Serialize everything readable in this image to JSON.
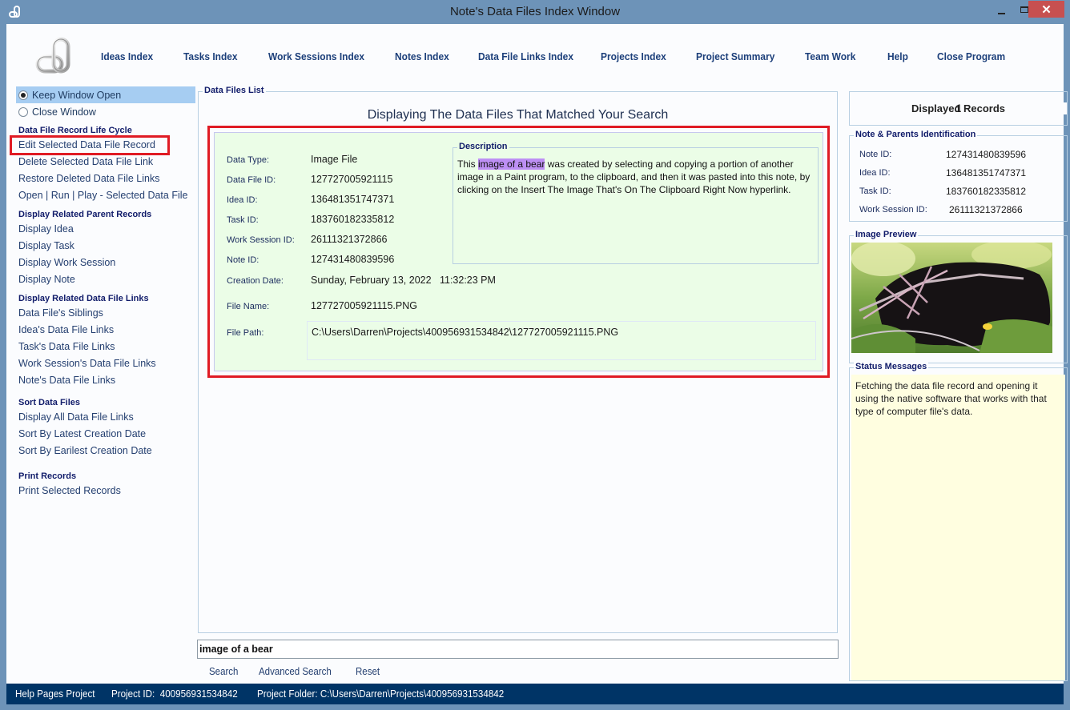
{
  "window": {
    "title": "Note's Data Files Index Window",
    "icons": [
      "app-link-icon",
      "minimize-icon",
      "maximize-icon",
      "close-icon"
    ]
  },
  "topnav": [
    {
      "label": "Ideas Index",
      "mnemonic": "I"
    },
    {
      "label": "Tasks Index",
      "mnemonic": "T"
    },
    {
      "label": "Work Sessions Index",
      "mnemonic": "W"
    },
    {
      "label": "Notes Index",
      "mnemonic": "N"
    },
    {
      "label": "Data File Links Index",
      "mnemonic": "D"
    },
    {
      "label": "Projects Index",
      "mnemonic": ""
    },
    {
      "label": "Project Summary",
      "mnemonic": "P"
    },
    {
      "label": "Team Work",
      "mnemonic": "e"
    },
    {
      "label": "Help",
      "mnemonic": "H"
    },
    {
      "label": "Close Program",
      "mnemonic": "C"
    }
  ],
  "sidebar": {
    "window_options": [
      {
        "label": "Keep Window Open",
        "selected": true
      },
      {
        "label": "Close Window",
        "selected": false
      }
    ],
    "sections": [
      {
        "heading": "Data File Record Life Cycle",
        "items": [
          "Edit Selected Data File Record",
          "Delete Selected Data File Link",
          "Restore Deleted Data File Links",
          "Open | Run | Play - Selected Data File"
        ]
      },
      {
        "heading": "Display Related Parent Records",
        "items": [
          "Display Idea",
          "Display Task",
          "Display Work Session",
          "Display Note"
        ]
      },
      {
        "heading": "Display Related Data File Links",
        "items": [
          "Data File's Siblings",
          "Idea's Data File Links",
          "Task's Data File Links",
          "Work Session's Data File Links",
          "Note's Data File Links"
        ]
      },
      {
        "heading": "Sort Data Files",
        "items": [
          "Display All Data File Links",
          "Sort By Latest Creation Date",
          "Sort By Earilest Creation Date"
        ]
      },
      {
        "heading": "Print Records",
        "items": [
          "Print Selected Records"
        ]
      }
    ],
    "highlighted_item": "Edit Selected Data File Record"
  },
  "files_list": {
    "group_label": "Data Files List",
    "heading": "Displaying The Data Files That Matched Your Search",
    "record": {
      "fields": [
        {
          "label": "Data Type:",
          "value": "Image File"
        },
        {
          "label": "Data File ID:",
          "value": "127727005921115"
        },
        {
          "label": "Idea ID:",
          "value": "136481351747371"
        },
        {
          "label": "Task ID:",
          "value": "183760182335812"
        },
        {
          "label": "Work Session ID:",
          "value": "26111321372866"
        },
        {
          "label": "Note ID:",
          "value": "127431480839596"
        },
        {
          "label": "Creation Date:",
          "value": "Sunday, February 13, 2022   11:32:23 PM"
        },
        {
          "label": "File Name:",
          "value": "127727005921115.PNG"
        },
        {
          "label": "File Path:",
          "value": "C:\\Users\\Darren\\Projects\\400956931534842\\127727005921115.PNG"
        }
      ],
      "description_label": "Description",
      "description_pre": "This ",
      "description_highlight": "image of a bear",
      "description_post": " was created by selecting and copying a portion of another image in a Paint program, to the clipboard, and then it was pasted into this note, by clicking on the Insert The Image That's On The Clipboard Right Now hyperlink."
    }
  },
  "search": {
    "value": "image of a bear",
    "actions": [
      {
        "label": "Search",
        "mnemonic": "S"
      },
      {
        "label": "Advanced Search",
        "mnemonic": "A"
      },
      {
        "label": "Reset",
        "mnemonic": "R"
      }
    ]
  },
  "right_panel": {
    "displayed_records_label": "Displayed Records",
    "displayed_records": "1",
    "ident_label": "Note & Parents Identification",
    "ident": [
      {
        "label": "Note ID:",
        "value": "127431480839596"
      },
      {
        "label": "Idea ID:",
        "value": "136481351747371"
      },
      {
        "label": "Task ID:",
        "value": "183760182335812"
      },
      {
        "label": "Work Session ID:",
        "value": "26111321372866"
      }
    ],
    "preview_label": "Image Preview",
    "preview_subject": "black bear in green foliage",
    "status_label": "Status Messages",
    "status_text": "Fetching the data file record and opening it using the native software that works with that type of computer file's data."
  },
  "statusbar": {
    "project_name": "Help Pages Project",
    "project_id": "Project ID:  400956931534842",
    "project_folder": "Project Folder: C:\\Users\\Darren\\Projects\\400956931534842"
  },
  "colors": {
    "titlebar": "#6d93b8",
    "close_button": "#c75050",
    "nav_text": "#1c3f7a",
    "section_heading": "#111c6a",
    "highlight_outline": "#e01b24",
    "record_bg": "#ebfde7",
    "search_highlight": "#bd8ff4",
    "status_bg": "#fffee0",
    "statusbar": "#003466"
  }
}
